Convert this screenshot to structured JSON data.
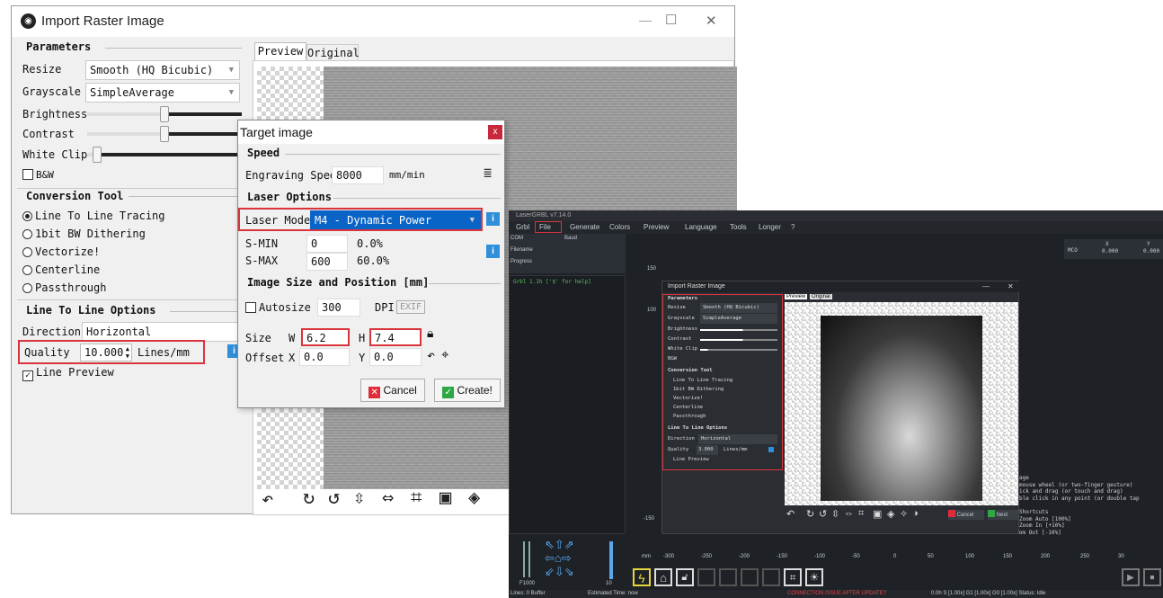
{
  "main": {
    "title": "Import Raster Image",
    "window_controls": {
      "minimize": "—",
      "maximize": "☐",
      "close": "✕"
    },
    "params_title": "Parameters",
    "resize_label": "Resize",
    "resize_value": "Smooth (HQ Bicubic)",
    "grayscale_label": "Grayscale",
    "grayscale_value": "SimpleAverage",
    "brightness_label": "Brightness",
    "contrast_label": "Contrast",
    "whiteclip_label": "White Clip",
    "bw_label": "B&W",
    "conversion_title": "Conversion Tool",
    "tools": [
      "Line To Line Tracing",
      "1bit BW Dithering",
      "Vectorize!",
      "Centerline",
      "Passthrough"
    ],
    "l2l_title": "Line To Line Options",
    "direction_label": "Direction",
    "direction_value": "Horizontal",
    "quality_label": "Quality",
    "quality_value": "10.000",
    "quality_unit": "Lines/mm",
    "line_preview_label": "Line Preview",
    "tab_preview": "Preview",
    "tab_original": "Original"
  },
  "target": {
    "title": "Target image",
    "close": "x",
    "speed_title": "Speed",
    "speed_label": "Engraving Speed",
    "speed_value": "8000",
    "speed_unit": "mm/min",
    "laser_title": "Laser Options",
    "laser_mode_label": "Laser Mode",
    "laser_mode_value": "M4 - Dynamic Power",
    "smin_label": "S-MIN",
    "smin_value": "0",
    "smin_pct": "0.0%",
    "smax_label": "S-MAX",
    "smax_value": "600",
    "smax_pct": "60.0%",
    "size_title": "Image Size and Position [mm]",
    "autosize_label": "Autosize",
    "dpi_value": "300",
    "dpi_label": "DPI",
    "exif_label": "EXIF",
    "size_label": "Size",
    "w_label": "W",
    "w_value": "6.2",
    "h_label": "H",
    "h_value": "7.4",
    "offset_label": "Offset",
    "x_label": "X",
    "x_value": "0.0",
    "y_label": "Y",
    "y_value": "0.0",
    "cancel_label": "Cancel",
    "create_label": "Create!"
  },
  "app": {
    "title": "LaserGRBL v7.14.0",
    "menu": [
      "Grbl",
      "File",
      "Generate",
      "Colors",
      "Preview",
      "Language",
      "Tools",
      "Longer",
      "?"
    ],
    "com_label": "COM",
    "baud_label": "Baud",
    "filename_label": "Filename",
    "progress_label": "Progress",
    "console_text": "Grbl 1.1h ['$' for help]",
    "coords": {
      "mco": "MCO",
      "x_label": "X",
      "x_value": "0.000",
      "y_label": "Y",
      "y_value": "0.000"
    },
    "y_ticks": [
      "150",
      "100",
      "-150"
    ],
    "x_ticks": [
      "mm",
      "-300",
      "-250",
      "-200",
      "-150",
      "-100",
      "-50",
      "0",
      "50",
      "100",
      "150",
      "200",
      "250",
      "30"
    ],
    "help_lines": [
      "age",
      "mouse wheel (or two-finger gesture)",
      "ick and drag (or touch and drag)",
      "ble click in any point (or double tap",
      "Shortcuts",
      "Zoom Auto  [100%]",
      "Zoom In    [+10%]",
      "Ctrl + -  Zoom Out   [-10%]"
    ],
    "jog_f": "F1000",
    "jog_step": "10",
    "status_left": "Lines: 0  Buffer",
    "status_est": "Estimated Time: now",
    "status_warning": "CONNECTION ISSUE AFTER UPDATE?",
    "status_right": "0.0h  S [1.00x]  G1 [1.00x]  G0 [1.00x]   Status: Idle",
    "warning_color": "#e0454b"
  },
  "mini": {
    "title": "Import Raster Image",
    "params_title": "Parameters",
    "resize_label": "Resize",
    "resize_value": "Smooth (HQ Bicubic)",
    "grayscale_label": "Grayscale",
    "grayscale_value": "SimpleAverage",
    "brightness_label": "Brightness",
    "contrast_label": "Contrast",
    "whiteclip_label": "White Clip",
    "bw_label": "B&W",
    "conversion_title": "Conversion Tool",
    "tools": [
      "Line To Line Tracing",
      "1bit BW Dithering",
      "Vectorize!",
      "Centerline",
      "Passthrough"
    ],
    "l2l_title": "Line To Line Options",
    "direction_label": "Direction",
    "direction_value": "Horizontal",
    "quality_label": "Quality",
    "quality_value": "3.000",
    "quality_unit": "Lines/mm",
    "line_preview_label": "Line Preview",
    "tab_preview": "Preview",
    "tab_original": "Original",
    "cancel_label": "Cancel",
    "next_label": "Next"
  },
  "colors": {
    "highlight": "#d9343c",
    "accent_blue": "#2f8fd8",
    "selection": "#0a64c8"
  }
}
